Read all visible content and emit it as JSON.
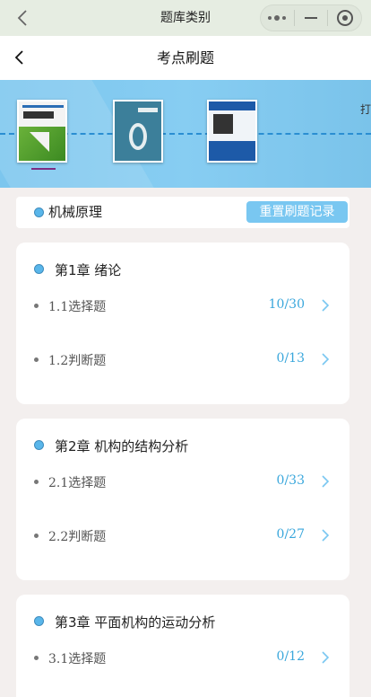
{
  "wechat_bar": {
    "title": "题库类别"
  },
  "header": {
    "title": "考点刷题"
  },
  "banner": {
    "edge_text": "打",
    "books": [
      {
        "name": "机械原理",
        "selected": true
      },
      {
        "name": "book-2",
        "selected": false
      },
      {
        "name": "book-3",
        "selected": false
      }
    ]
  },
  "course": {
    "name": "机械原理",
    "reset_label": "重置刷题记录"
  },
  "chapters": [
    {
      "title": "第1章 绪论",
      "items": [
        {
          "label": "1.1选择题",
          "count": "10/30"
        },
        {
          "label": "1.2判断题",
          "count": "0/13"
        }
      ]
    },
    {
      "title": "第2章 机构的结构分析",
      "items": [
        {
          "label": "2.1选择题",
          "count": "0/33"
        },
        {
          "label": "2.2判断题",
          "count": "0/27"
        }
      ]
    },
    {
      "title": "第3章 平面机构的运动分析",
      "items": [
        {
          "label": "3.1选择题",
          "count": "0/12"
        }
      ]
    }
  ],
  "colors": {
    "accent": "#3aa7dc",
    "button": "#79c7f1",
    "dot": "#59b6ea",
    "banner": "#87cdf2"
  }
}
